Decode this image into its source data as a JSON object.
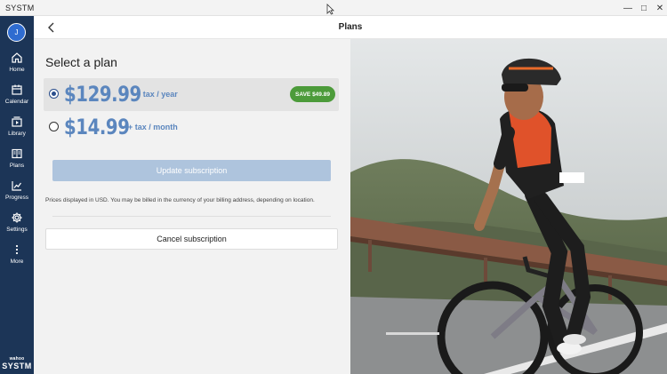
{
  "window": {
    "title": "SYSTM"
  },
  "header": {
    "title": "Plans"
  },
  "sidebar": {
    "avatar_initial": "J",
    "items": [
      {
        "label": "Home",
        "icon": "home-icon"
      },
      {
        "label": "Calendar",
        "icon": "calendar-icon"
      },
      {
        "label": "Library",
        "icon": "library-icon"
      },
      {
        "label": "Plans",
        "icon": "plans-icon"
      },
      {
        "label": "Progress",
        "icon": "progress-icon"
      },
      {
        "label": "Settings",
        "icon": "gear-icon"
      },
      {
        "label": "More",
        "icon": "more-icon"
      }
    ],
    "brand_small": "wahoo",
    "brand_big": "SYSTM"
  },
  "plans": {
    "heading": "Select a plan",
    "options": [
      {
        "price": "$129.99",
        "period": "+ tax / year",
        "badge": "SAVE $49.89",
        "selected": true
      },
      {
        "price": "$14.99",
        "period": "+ tax / month",
        "selected": false
      }
    ],
    "update_label": "Update subscription",
    "disclaimer": "Prices displayed in USD. You may be billed in the currency of your billing address, depending on location.",
    "cancel_label": "Cancel subscription"
  },
  "colors": {
    "sidebar_bg": "#1c3557",
    "price_blue": "#5b86be",
    "badge_green": "#4c9b3a",
    "disabled_button": "#aec4dd"
  }
}
